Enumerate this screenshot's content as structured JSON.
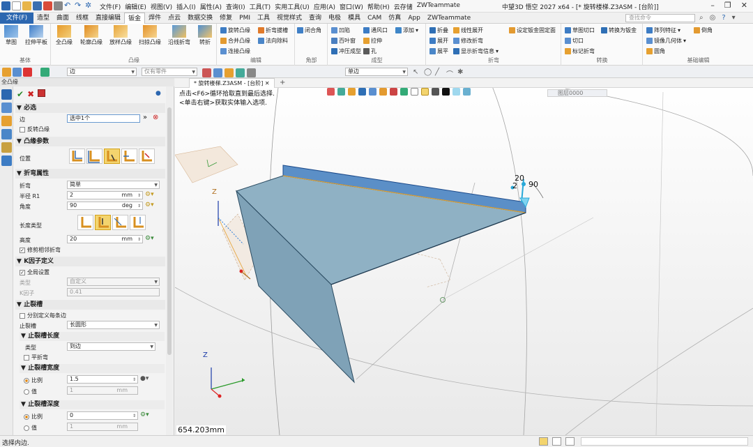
{
  "app": {
    "title": "中望3D 悟空 2027 x64 - [* 旋转楼梯.Z3ASM - [台阶]]",
    "menu": [
      "文件(F)",
      "编辑(E)",
      "视图(V)",
      "插入(I)",
      "属性(A)",
      "查询(I)",
      "工具(T)",
      "实用工具(U)",
      "应用(A)",
      "窗口(W)",
      "帮助(H)",
      "云存储",
      "ZWTeammate"
    ]
  },
  "ribbon_tabs": [
    "文件(F)",
    "造型",
    "曲面",
    "线框",
    "直接编辑",
    "钣金",
    "焊件",
    "点云",
    "数据交换",
    "修复",
    "PMI",
    "工具",
    "视觉样式",
    "查询",
    "电极",
    "模具",
    "CAM",
    "仿真",
    "App",
    "ZWTeammate"
  ],
  "active_tab": "钣金",
  "command_search": {
    "placeholder": "查找命令"
  },
  "ribbon": {
    "base": {
      "label": "基体",
      "buttons": [
        "草图",
        "拉伸平板"
      ]
    },
    "flange": {
      "label": "凸缘",
      "buttons": [
        "全凸缘",
        "轮廓凸缘",
        "放样凸缘",
        "扫掠凸缘",
        "沿线折弯",
        "转折"
      ]
    },
    "edit": {
      "label": "编辑",
      "items": [
        "旋转凸缘",
        "合并凸缘",
        "连接凸缘",
        "折弯拔槽",
        "法向除料"
      ]
    },
    "corner": {
      "label": "角部",
      "items": [
        "闭合角"
      ]
    },
    "form": {
      "label": "成型",
      "items": [
        "凹陷",
        "百叶窗",
        "冲压成型",
        "通风口",
        "拉伸",
        "孔",
        "添加"
      ]
    },
    "bend": {
      "label": "折弯",
      "items": [
        "折叠",
        "展开",
        "展平",
        "线性展开",
        "修改折弯",
        "显示折弯信息",
        "设定钣金固定面"
      ]
    },
    "convert": {
      "label": "转换",
      "items": [
        "草图切口",
        "切口",
        "标记折弯",
        "转换为钣金"
      ]
    },
    "basic_edit": {
      "label": "基础编辑",
      "items": [
        "阵列特征",
        "镜像几何体",
        "圆角",
        "倒角"
      ]
    }
  },
  "toolbar": {
    "filter_value": "边",
    "scope_value": "仅有零件",
    "mode_value": "单边"
  },
  "panel": {
    "title": "全凸缘",
    "required": {
      "title": "必选",
      "edge_label": "边",
      "edge_value": "选中1个",
      "reverse_label": "反转凸缘"
    },
    "params": {
      "title": "凸缘参数",
      "position_label": "位置"
    },
    "bend": {
      "title": "折弯属性",
      "type_label": "折弯",
      "type_value": "简单",
      "radius_label": "半径 R1",
      "radius_value": "2",
      "radius_unit": "mm",
      "angle_label": "角度",
      "angle_value": "90",
      "angle_unit": "deg",
      "length_type_label": "长度类型",
      "height_label": "高度",
      "height_value": "20",
      "height_unit": "mm",
      "trim_label": "修剪相邻折弯"
    },
    "kfactor": {
      "title": "K因子定义",
      "global_label": "全局设置",
      "type_label": "类型",
      "type_value": "自定义",
      "k_label": "K因子",
      "k_value": "0.41"
    },
    "relief": {
      "title": "止裂槽",
      "separate_label": "分别定义每条边",
      "relief_label": "止裂槽",
      "relief_value": "长圆形",
      "length_title": "止裂槽长度",
      "length_type_label": "类型",
      "length_type_value": "到边",
      "flat_label": "平折弯",
      "width_title": "止裂槽宽度",
      "ratio_label": "比例",
      "width_ratio": "1.5",
      "value_label": "值",
      "width_value": "1",
      "width_unit": "mm",
      "depth_title": "止裂槽深度",
      "depth_ratio": "0",
      "depth_value": "1",
      "depth_unit": "mm"
    }
  },
  "viewport": {
    "doc_tab": "* 旋转楼梯.Z3ASM - [台阶]",
    "hint_line1": "点击<F6>循环拾取直到最后选择.",
    "hint_line2": "<单击右键>获取实体输入选项.",
    "view_filter": "图层0000",
    "dim_height": "20",
    "dim_radius": "2",
    "dim_angle": "90",
    "measure": "654.203mm",
    "axis_z": "Z"
  },
  "status": {
    "text": "选择内边."
  },
  "colors": {
    "accent": "#2c67b0",
    "part_face": "#8fb1c4",
    "part_edge": "#2a4a60",
    "flange": "#5b8fc7",
    "highlight": "#f3d46e"
  }
}
